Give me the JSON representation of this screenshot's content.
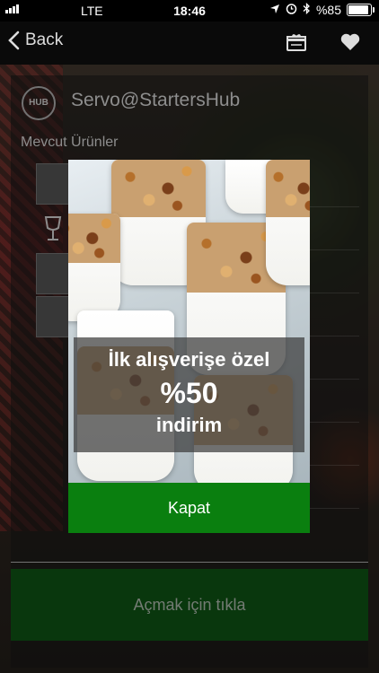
{
  "status_bar": {
    "carrier": "LTE",
    "time": "18:46",
    "battery": "%85"
  },
  "nav": {
    "back_label": "Back"
  },
  "store": {
    "logo_text": "HUB",
    "name": "Servo@StartersHub",
    "section_title": "Mevcut Ürünler"
  },
  "modal": {
    "line1": "İlk alışverişe özel",
    "line2": "%50",
    "line3": "indirim",
    "close_label": "Kapat"
  },
  "footer": {
    "open_label": "Açmak için tıkla"
  },
  "colors": {
    "close_button": "#0a7f0f",
    "open_button": "#0d4a12"
  }
}
